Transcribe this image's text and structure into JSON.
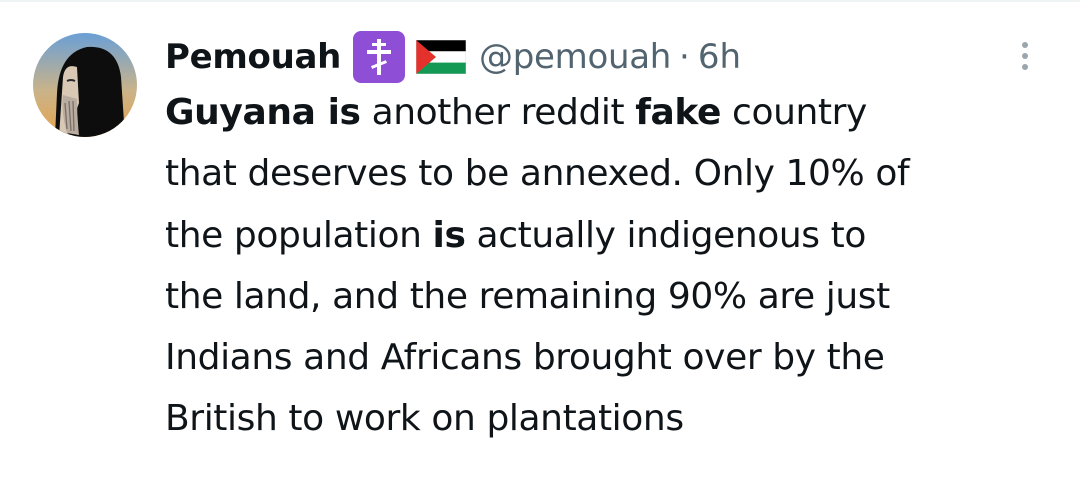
{
  "tweet": {
    "author": {
      "display_name": "Pemouah",
      "handle": "@pemouah",
      "avatar_icon": "avatar-portrait-icon",
      "badges": [
        {
          "icon": "orthodox-cross-icon",
          "color": "#8f4ed6"
        },
        {
          "icon": "palestine-flag-icon"
        }
      ]
    },
    "separator": "·",
    "time": "6h",
    "more_icon": "more-vertical-icon",
    "text_lines": [
      [
        {
          "text": "Guyana is",
          "bold": true
        },
        {
          "text": " another reddit ",
          "bold": false
        },
        {
          "text": "fake",
          "bold": true
        },
        {
          "text": " country",
          "bold": false
        }
      ],
      [
        {
          "text": "that deserves to be annexed. Only 10% of",
          "bold": false
        }
      ],
      [
        {
          "text": "the population ",
          "bold": false
        },
        {
          "text": "is",
          "bold": true
        },
        {
          "text": " actually indigenous to",
          "bold": false
        }
      ],
      [
        {
          "text": "the land, and the remaining 90% are just",
          "bold": false
        }
      ],
      [
        {
          "text": "Indians and Africans brought over by the",
          "bold": false
        }
      ],
      [
        {
          "text": "British to work on plantations",
          "bold": false
        }
      ]
    ]
  },
  "colors": {
    "text_primary": "#0f1419",
    "text_secondary": "#536471",
    "badge_purple": "#8f4ed6"
  }
}
